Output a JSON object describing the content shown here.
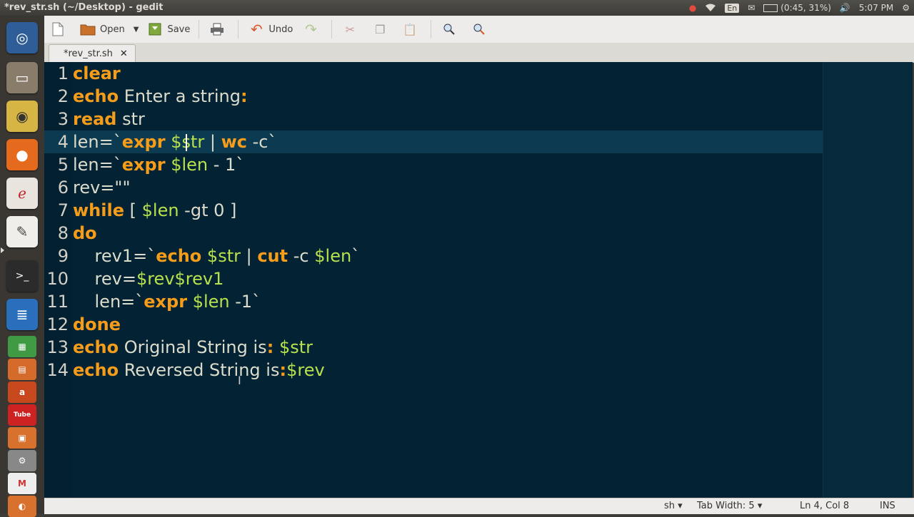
{
  "window": {
    "title": "*rev_str.sh (~/Desktop) - gedit"
  },
  "tray": {
    "battery": "(0:45, 31%)",
    "lang": "En",
    "clock": "5:07 PM"
  },
  "toolbar": {
    "open_label": "Open",
    "save_label": "Save",
    "undo_label": "Undo"
  },
  "tabs": [
    {
      "label": "*rev_str.sh",
      "close": "✕"
    }
  ],
  "editor": {
    "lines": [
      {
        "num": "1",
        "parts": [
          [
            "clear",
            "kw"
          ]
        ]
      },
      {
        "num": "2",
        "parts": [
          [
            "echo",
            "kw"
          ],
          [
            " Enter a string",
            ""
          ],
          [
            ":",
            "kw"
          ]
        ]
      },
      {
        "num": "3",
        "parts": [
          [
            "read",
            "kw"
          ],
          [
            " str",
            ""
          ]
        ]
      },
      {
        "num": "4",
        "parts": [
          [
            "len=`",
            ""
          ],
          [
            "expr",
            "kw"
          ],
          [
            " ",
            ""
          ],
          [
            "$str",
            "var"
          ],
          [
            " | ",
            ""
          ],
          [
            "wc",
            "kw"
          ],
          [
            " -c`",
            ""
          ]
        ]
      },
      {
        "num": "5",
        "parts": [
          [
            "len=`",
            ""
          ],
          [
            "expr",
            "kw"
          ],
          [
            " ",
            ""
          ],
          [
            "$len",
            "var"
          ],
          [
            " - 1`",
            ""
          ]
        ]
      },
      {
        "num": "6",
        "parts": [
          [
            "rev=\"\"",
            ""
          ]
        ]
      },
      {
        "num": "7",
        "parts": [
          [
            "while",
            "kw"
          ],
          [
            " [ ",
            ""
          ],
          [
            "$len",
            "var"
          ],
          [
            " -gt 0 ]",
            ""
          ]
        ]
      },
      {
        "num": "8",
        "parts": [
          [
            "do",
            "kw"
          ]
        ]
      },
      {
        "num": "9",
        "parts": [
          [
            "    rev1=`",
            ""
          ],
          [
            "echo",
            "kw"
          ],
          [
            " ",
            ""
          ],
          [
            "$str",
            "var"
          ],
          [
            " | ",
            ""
          ],
          [
            "cut",
            "kw"
          ],
          [
            " -c ",
            ""
          ],
          [
            "$len",
            "var"
          ],
          [
            "`",
            ""
          ]
        ]
      },
      {
        "num": "10",
        "parts": [
          [
            "    rev=",
            ""
          ],
          [
            "$rev$rev1",
            "var"
          ]
        ]
      },
      {
        "num": "11",
        "parts": [
          [
            "    len=`",
            ""
          ],
          [
            "expr",
            "kw"
          ],
          [
            " ",
            ""
          ],
          [
            "$len",
            "var"
          ],
          [
            " -1`",
            ""
          ]
        ]
      },
      {
        "num": "12",
        "parts": [
          [
            "done",
            "kw"
          ]
        ]
      },
      {
        "num": "13",
        "parts": [
          [
            "echo",
            "kw"
          ],
          [
            " Original String is",
            ""
          ],
          [
            ":",
            "kw"
          ],
          [
            " ",
            ""
          ],
          [
            "$str",
            "var"
          ]
        ]
      },
      {
        "num": "14",
        "parts": [
          [
            "echo",
            "kw"
          ],
          [
            " Reversed String is",
            ""
          ],
          [
            ":",
            "kw"
          ],
          [
            "$rev",
            "var"
          ]
        ]
      }
    ]
  },
  "statusbar": {
    "language": "sh ▾",
    "tab_width": "Tab Width: 5 ▾",
    "position": "Ln 4, Col 8",
    "mode": "INS"
  },
  "colors": {
    "keyword": "#f59d1a",
    "variable": "#b7e04e",
    "background": "#032334"
  }
}
